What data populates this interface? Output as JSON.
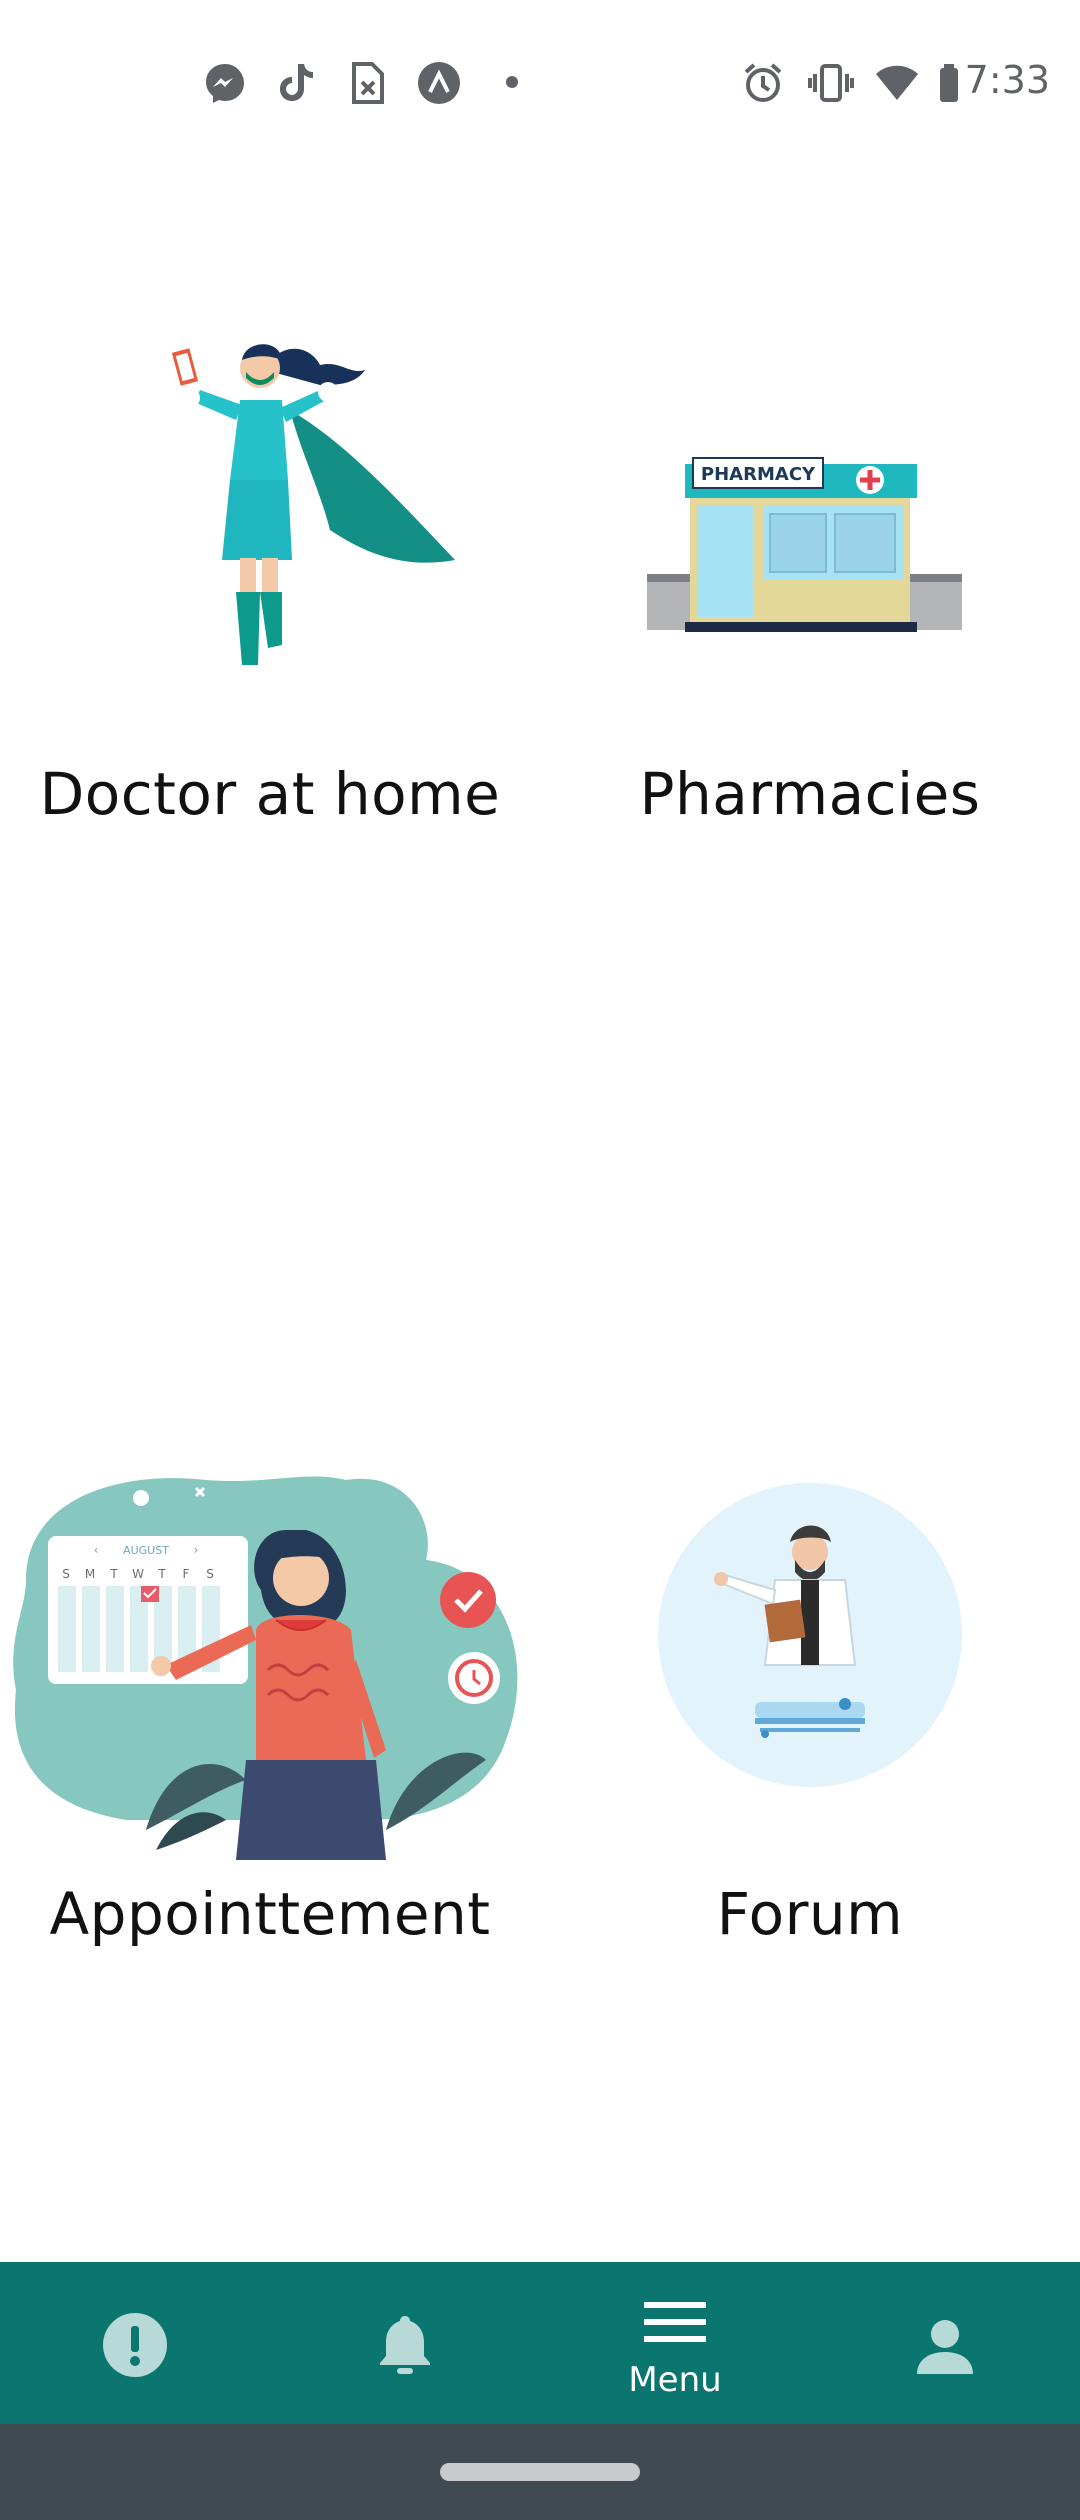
{
  "status_bar": {
    "time": "7:33",
    "left_icons": [
      "messenger-icon",
      "tiktok-icon",
      "file-icon",
      "arrow-icon",
      "dot-icon"
    ],
    "right_icons": [
      "alarm-icon",
      "vibrate-icon",
      "wifi-icon",
      "battery-icon"
    ]
  },
  "tiles": [
    {
      "label": "Doctor at home"
    },
    {
      "label": "Pharmacies",
      "sign_text": "PHARMACY"
    },
    {
      "label": "Appointtement",
      "calendar_month": "AUGUST",
      "calendar_days": [
        "S",
        "M",
        "T",
        "W",
        "T",
        "F",
        "S"
      ]
    },
    {
      "label": "Forum"
    }
  ],
  "bottom_nav": {
    "items": [
      {
        "icon": "alert-icon",
        "label": ""
      },
      {
        "icon": "bell-icon",
        "label": ""
      },
      {
        "icon": "menu-icon",
        "label": "Menu"
      },
      {
        "icon": "person-icon",
        "label": ""
      }
    ]
  },
  "colors": {
    "nav_bg": "#0b7670",
    "accent_teal": "#16a39a",
    "system_nav": "#3f4a51"
  }
}
